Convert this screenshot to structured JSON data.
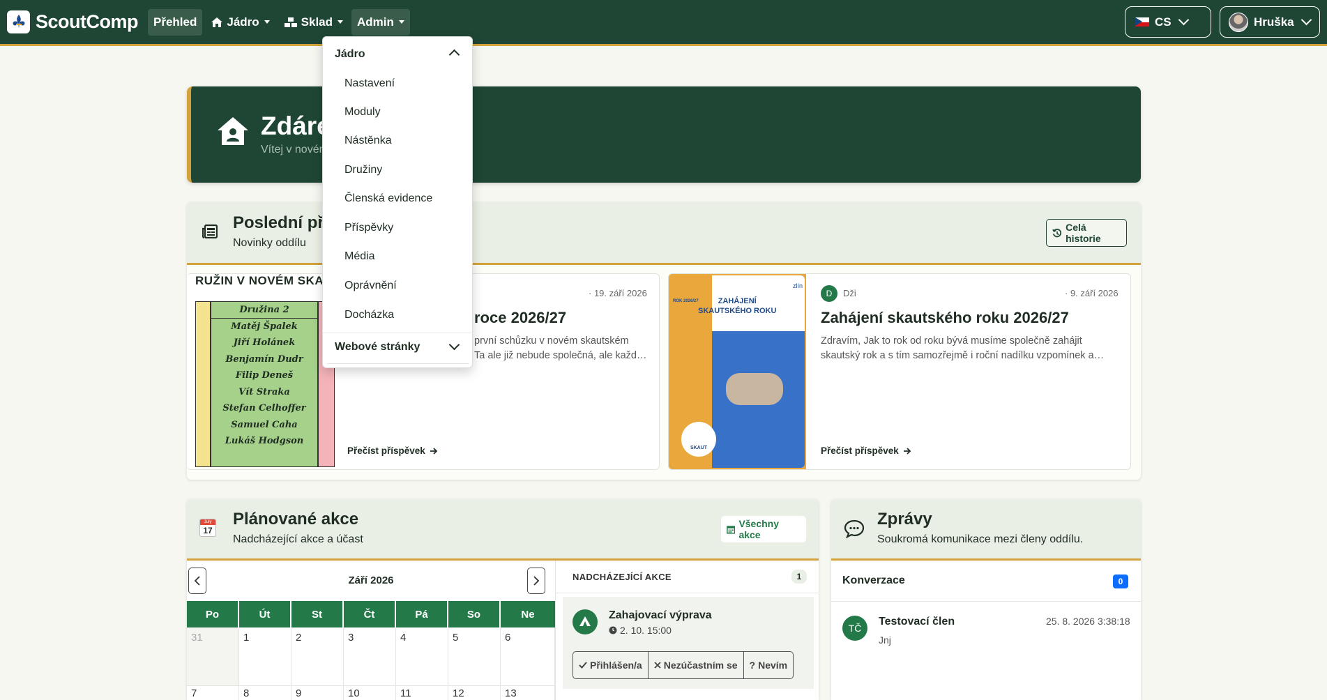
{
  "navbar": {
    "brand": "ScoutComp",
    "items": [
      {
        "label": "Přehled"
      },
      {
        "label": "Jádro"
      },
      {
        "label": "Sklad"
      },
      {
        "label": "Admin"
      }
    ],
    "language": "CS",
    "user": "Hruška"
  },
  "hero": {
    "title": "Zdáre",
    "subtitle": "Vítej v novém"
  },
  "posts": {
    "title": "Poslední přís",
    "subtitle": "Novinky oddílu",
    "history_button": "Celá historie",
    "items": [
      {
        "roster_header": "RUŽIN V NOVÉM SKA",
        "roster_column": "Družina 2",
        "roster_members": [
          "Matěj Špalek",
          "Jiří Holánek",
          "Benjamín Dudr",
          "Filip Deneš",
          "Vít Straka",
          "Stefan Celhoffer",
          "Samuel Caha",
          "Lukáš Hodgson"
        ],
        "date": "· 19. září 2026",
        "title": "roce 2026/27",
        "excerpt_lines": [
          "první schůzku v novém skautském",
          "Ta ale již nebude společná, ale každ…"
        ],
        "link": "Přečíst příspěvek"
      },
      {
        "author_initial": "D",
        "author": "Dži",
        "date": "· 9. září 2026",
        "title": "Zahájení skautského roku 2026/27",
        "excerpt_lines": [
          "Zdravím, Jak to rok od roku bývá musíme společně zahájit",
          "skautský rok a s tím samozřejmě i roční nadílku vzpomínek a…"
        ],
        "link": "Přečíst příspěvek",
        "poster_title_lines": [
          "ZAHÁJENÍ",
          "SKAUTSKÉHO ROKU"
        ],
        "poster_tag": "ROK 2026/27",
        "poster_corner": "zlín",
        "poster_badge": "SKAUT"
      }
    ]
  },
  "events": {
    "title": "Plánované akce",
    "subtitle": "Nadcházející akce a účast",
    "all_button": "Všechny akce",
    "calendar_icon_month": "July",
    "calendar_icon_day": "17",
    "month_label": "Září 2026",
    "weekdays": [
      "Po",
      "Út",
      "St",
      "Čt",
      "Pá",
      "So",
      "Ne"
    ],
    "week1": [
      "31",
      "1",
      "2",
      "3",
      "4",
      "5",
      "6"
    ],
    "week2": [
      "7",
      "8",
      "9",
      "10",
      "11",
      "12",
      "13"
    ],
    "upcoming_title": "NADCHÁZEJÍCÍ AKCE",
    "upcoming_count": "1",
    "event_name": "Zahajovací výprava",
    "event_time": "2. 10. 15:00",
    "rsvp": [
      "Přihlášen/a",
      "Nezúčastním se",
      "Nevím"
    ]
  },
  "messages": {
    "title": "Zprávy",
    "subtitle": "Soukromá komunikace mezi členy oddílu.",
    "conversations_label": "Konverzace",
    "conversations_count": "0",
    "conversation": {
      "initials": "TČ",
      "name": "Testovací člen",
      "timestamp": "25. 8. 2026 3:38:18",
      "preview": "Jnj"
    }
  },
  "admin_menu": {
    "group1": "Jádro",
    "items": [
      "Nastavení",
      "Moduly",
      "Nástěnka",
      "Družiny",
      "Členská evidence",
      "Příspěvky",
      "Média",
      "Oprávnění",
      "Docházka"
    ],
    "group2": "Webové stránky"
  },
  "colors": {
    "primary": "#1f4634",
    "accent": "#d4a23a",
    "calendar_header": "#237a48",
    "badge_blue": "#0d6efd"
  }
}
